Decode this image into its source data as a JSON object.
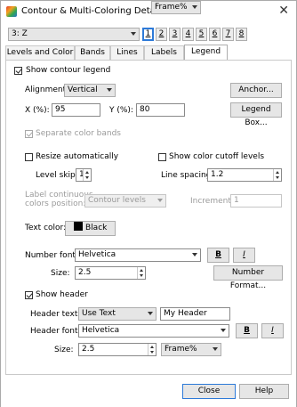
{
  "window": {
    "title": "Contour & Multi-Coloring Details",
    "close_glyph": "✕"
  },
  "variable_select": {
    "value": "3: Z"
  },
  "number_tabs": [
    "1",
    "2",
    "3",
    "4",
    "5",
    "6",
    "7",
    "8"
  ],
  "tabs": [
    "Levels and Color",
    "Bands",
    "Lines",
    "Labels",
    "Legend"
  ],
  "legend": {
    "show_contour_legend": "Show contour legend",
    "alignment_label": "Alignment:",
    "alignment_value": "Vertical",
    "anchor_button": "Anchor...",
    "x_label": "X (%):",
    "x_value": "95",
    "y_label": "Y (%):",
    "y_value": "80",
    "legend_box_button": "Legend Box...",
    "separate_color_bands": "Separate color bands",
    "resize_automatically": "Resize automatically",
    "show_color_cutoff": "Show color cutoff levels",
    "level_skip_label": "Level skip:",
    "level_skip_value": "1",
    "line_spacing_label": "Line spacing:",
    "line_spacing_value": "1.2",
    "label_position_label_1": "Label continuous",
    "label_position_label_2": "colors position:",
    "label_position_value": "Contour levels",
    "increment_label": "Increment:",
    "increment_value": "1",
    "text_color_label": "Text color:",
    "text_color_value": "Black",
    "number_font_label": "Number font:",
    "number_font_value": "Helvetica",
    "bold_glyph": "B",
    "italic_glyph": "I",
    "size_label": "Size:",
    "number_size_value": "2.5",
    "number_units_value": "Frame%",
    "number_format_button": "Number Format...",
    "show_header": "Show header",
    "header_text_label": "Header text:",
    "header_text_mode": "Use Text",
    "header_text_value": "My Header",
    "header_font_label": "Header font:",
    "header_font_value": "Helvetica",
    "header_size_label": "Size:",
    "header_size_value": "2.5",
    "header_units_value": "Frame%"
  },
  "footer": {
    "close_button": "Close",
    "help_button": "Help"
  },
  "colors": {
    "accent": "#2d7ad8",
    "button_bg": "#e6e6e6",
    "text_color_swatch": "#000000"
  },
  "icons": [
    "app-icon",
    "dropdown-arrow-icon",
    "spin-arrows-icon",
    "checkbox-checked-icon"
  ]
}
